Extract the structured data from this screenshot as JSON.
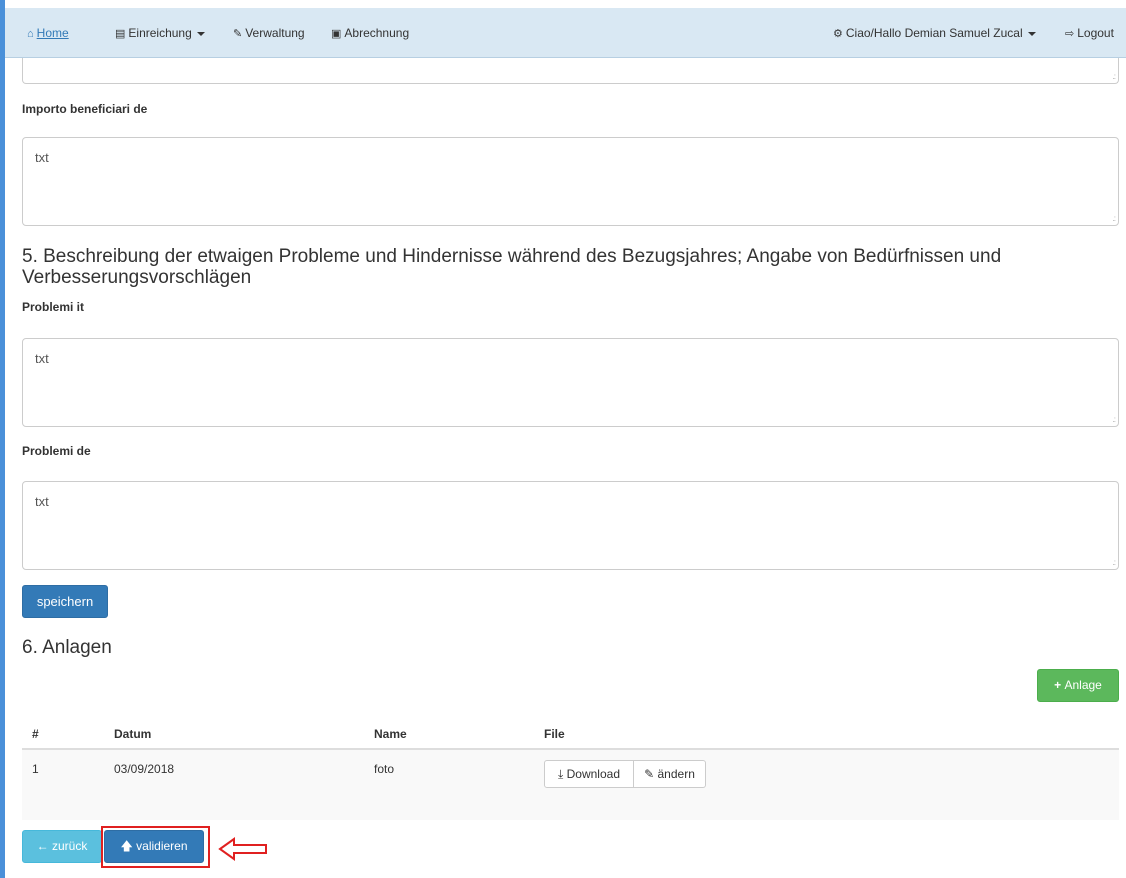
{
  "nav": {
    "home": "Home",
    "einreichung": "Einreichung",
    "verwaltung": "Verwaltung",
    "abrechnung": "Abrechnung",
    "user": "Ciao/Hallo Demian Samuel Zucal",
    "logout": "Logout"
  },
  "fields": {
    "importo_de_label": "Importo beneficiari de",
    "importo_de_value": "txt",
    "problemi_it_label": "Problemi it",
    "problemi_it_value": "txt",
    "problemi_de_label": "Problemi de",
    "problemi_de_value": "txt"
  },
  "section5": {
    "title": "5. Beschreibung der etwaigen Probleme und Hindernisse während des Bezugsjahres; Angabe von Bedürfnissen und Verbesserungsvorschlägen"
  },
  "save_label": "speichern",
  "section6": {
    "title": "6. Anlagen",
    "add_label": "Anlage"
  },
  "table": {
    "headers": [
      "#",
      "Datum",
      "Name",
      "File"
    ],
    "rows": [
      {
        "num": "1",
        "date": "03/09/2018",
        "name": "foto",
        "download": "Download",
        "change": "ändern"
      }
    ]
  },
  "footer": {
    "back_label": "zurück",
    "validate_label": "validieren"
  },
  "colors": {
    "primary": "#337ab7",
    "success": "#5cb85c",
    "info": "#5bc0de",
    "highlight": "#e02020"
  }
}
